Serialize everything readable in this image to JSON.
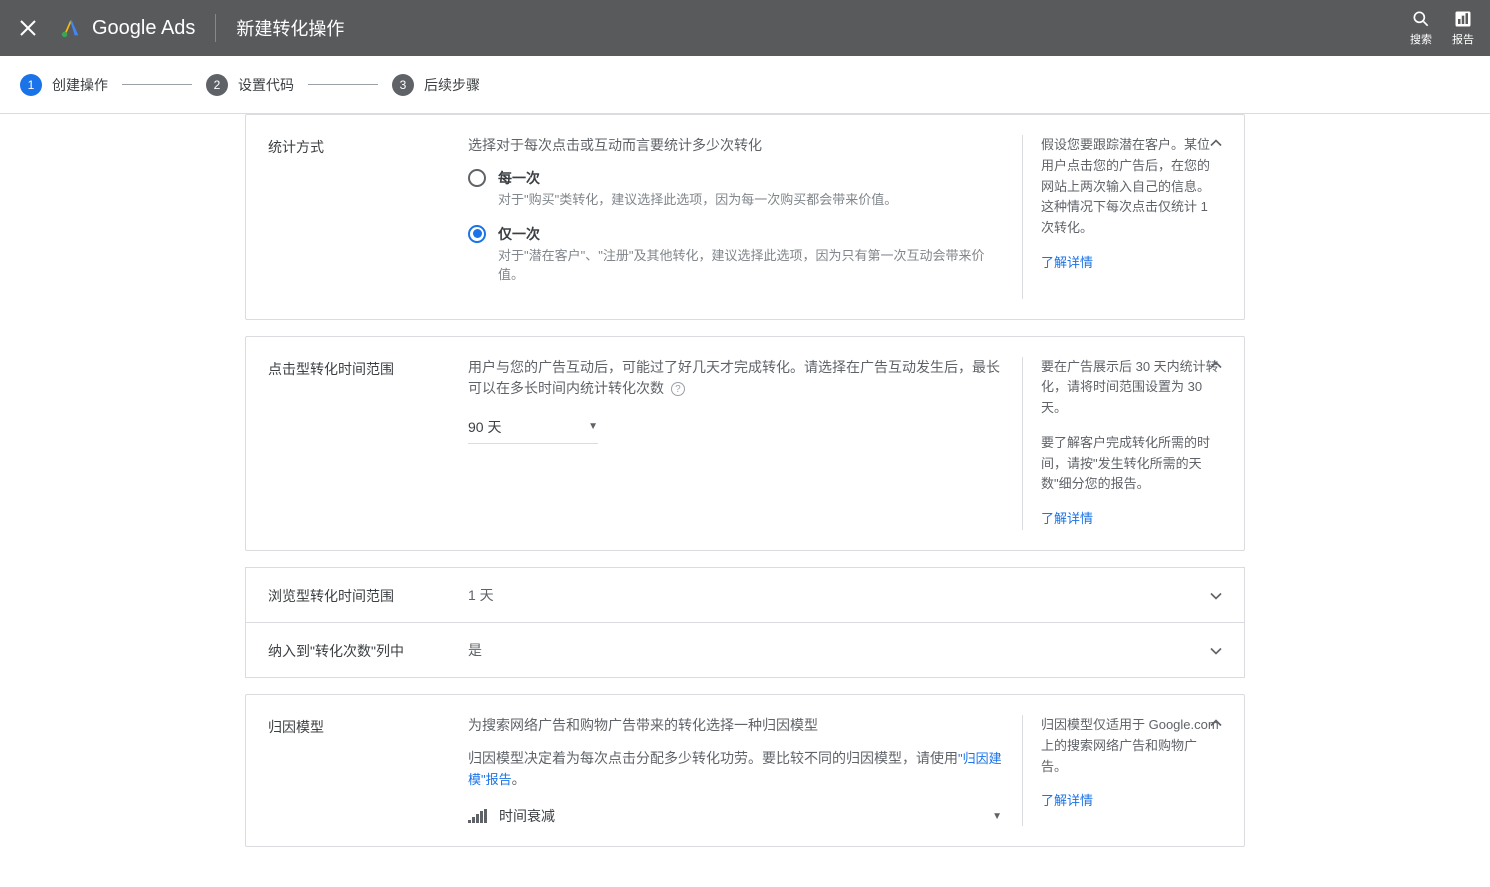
{
  "header": {
    "brand": "Google Ads",
    "title": "新建转化操作",
    "search_label": "搜索",
    "reports_label": "报告"
  },
  "stepper": {
    "s1": {
      "num": "1",
      "label": "创建操作"
    },
    "s2": {
      "num": "2",
      "label": "设置代码"
    },
    "s3": {
      "num": "3",
      "label": "后续步骤"
    }
  },
  "count_card": {
    "label": "统计方式",
    "desc": "选择对于每次点击或互动而言要统计多少次转化",
    "opt1": {
      "title": "每一次",
      "sub": "对于\"购买\"类转化，建议选择此选项，因为每一次购买都会带来价值。"
    },
    "opt2": {
      "title": "仅一次",
      "sub": "对于\"潜在客户\"、\"注册\"及其他转化，建议选择此选项，因为只有第一次互动会带来价值。"
    },
    "side": "假设您要跟踪潜在客户。某位用户点击您的广告后，在您的网站上两次输入自己的信息。这种情况下每次点击仅统计 1 次转化。",
    "learn": "了解详情"
  },
  "click_card": {
    "label": "点击型转化时间范围",
    "desc": "用户与您的广告互动后，可能过了好几天才完成转化。请选择在广告互动发生后，最长可以在多长时间内统计转化次数",
    "value": "90 天",
    "side1": "要在广告展示后 30 天内统计转化，请将时间范围设置为 30 天。",
    "side2": "要了解客户完成转化所需的时间，请按\"发生转化所需的天数\"细分您的报告。",
    "learn": "了解详情"
  },
  "view_row": {
    "label": "浏览型转化时间范围",
    "value": "1 天"
  },
  "include_row": {
    "label": "纳入到\"转化次数\"列中",
    "value": "是"
  },
  "attr_card": {
    "label": "归因模型",
    "desc": "为搜索网络广告和购物广告带来的转化选择一种归因模型",
    "desc2_pre": "归因模型决定着为每次点击分配多少转化功劳。要比较不同的归因模型，请使用",
    "desc2_link": "\"归因建模\"报告",
    "desc2_post": "。",
    "value": "时间衰减",
    "side": "归因模型仅适用于 Google.com 上的搜索网络广告和购物广告。",
    "learn": "了解详情"
  }
}
